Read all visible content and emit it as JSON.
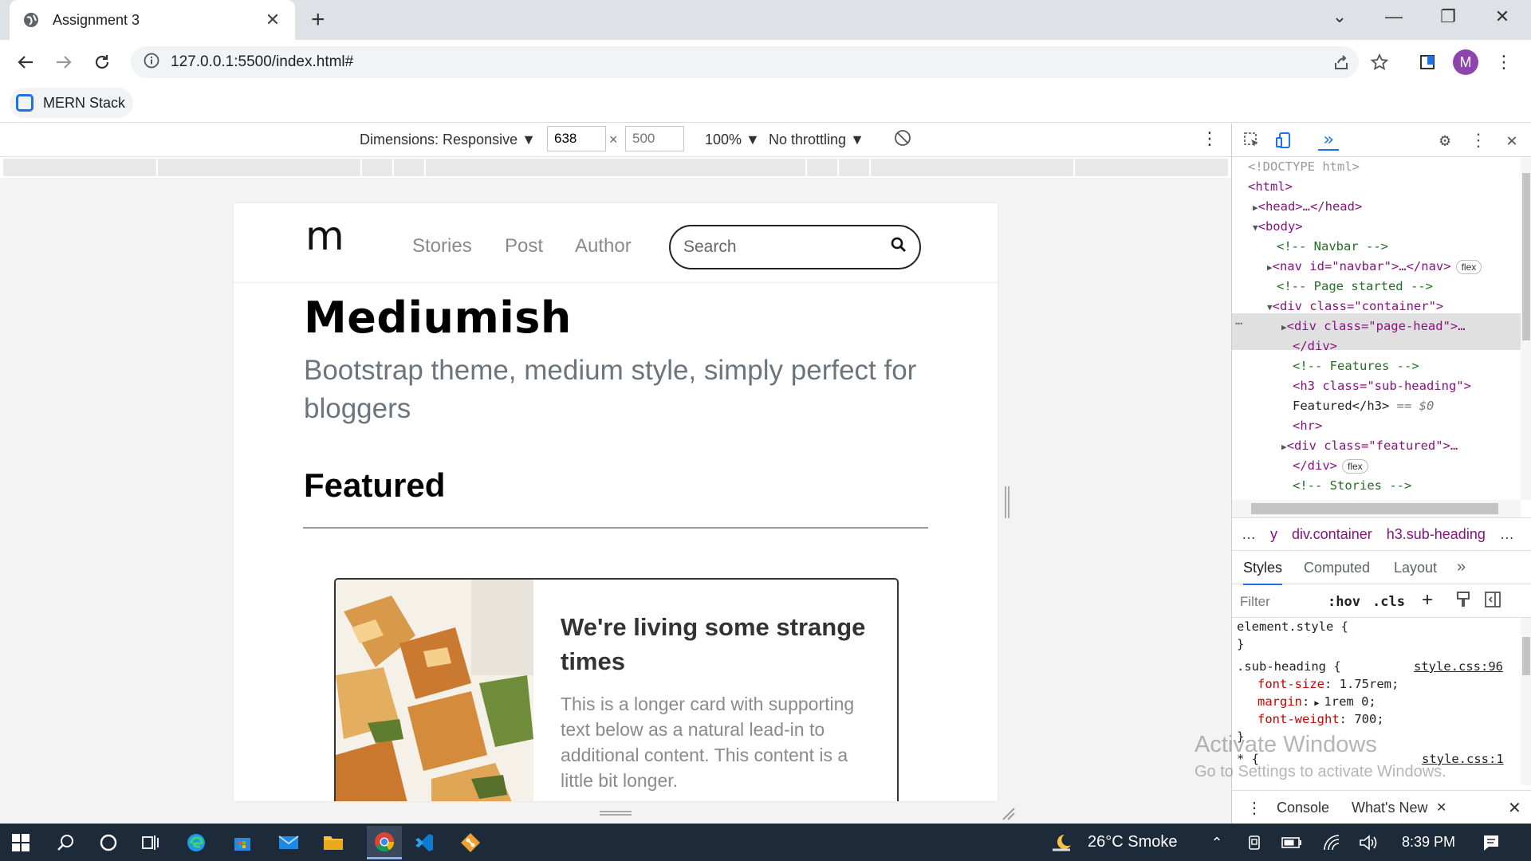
{
  "browser": {
    "tab_title": "Assignment 3",
    "url": "127.0.0.1:5500/index.html#",
    "bookmark": "MERN Stack",
    "profile_initial": "M"
  },
  "device_toolbar": {
    "dimensions": "Dimensions: Responsive",
    "width": "638",
    "height_placeholder": "500",
    "times": "×",
    "zoom": "100%",
    "throttling": "No throttling"
  },
  "site": {
    "logo": "m",
    "nav": [
      "Stories",
      "Post",
      "Author"
    ],
    "search_placeholder": "Search",
    "title": "Mediumish",
    "subtitle": "Bootstrap theme, medium style, simply perfect for bloggers",
    "section_heading": "Featured",
    "card_title": "We're living some strange times",
    "card_text": "This is a longer card with supporting text below as a natural lead-in to additional content. This content is a little bit longer."
  },
  "devtools": {
    "dom": [
      {
        "t": "<!DOCTYPE html>"
      },
      {
        "t": "<html>"
      },
      {
        "t": "<head>…</head>"
      },
      {
        "t": "<body>"
      },
      {
        "t": "<!-- Navbar -->"
      },
      {
        "t": "<nav id=\"navbar\">…</nav>",
        "pill": "flex"
      },
      {
        "t": "<!-- Page started -->"
      },
      {
        "t": "<div class=\"container\">"
      },
      {
        "t": "<div class=\"page-head\">…"
      },
      {
        "t": "</div>"
      },
      {
        "t": "<!-- Features -->"
      },
      {
        "t": "<h3 class=\"sub-heading\">"
      },
      {
        "t": "Featured</h3>",
        "suffix": "== $0"
      },
      {
        "t": "<hr>"
      },
      {
        "t": "<div class=\"featured\">…"
      },
      {
        "t": "</div>",
        "pill": "flex"
      },
      {
        "t": "<!-- Stories -->"
      }
    ],
    "crumbs": [
      "…",
      "y",
      "div.container",
      "h3.sub-heading",
      "…"
    ],
    "style_tabs": [
      "Styles",
      "Computed",
      "Layout"
    ],
    "filter_placeholder": "Filter",
    "hov": ":hov",
    "cls": ".cls",
    "rules": {
      "element_style": "element.style {",
      "close": "}",
      "selector": ".sub-heading {",
      "source": "style.css:96",
      "props": [
        {
          "name": "font-size",
          "value": "1.75rem;"
        },
        {
          "name": "margin",
          "value": "1rem 0;"
        },
        {
          "name": "font-weight",
          "value": "700;"
        }
      ],
      "universal": "* {",
      "source2": "style.css:1"
    },
    "drawer_tabs": [
      "Console",
      "What's New"
    ]
  },
  "watermark": {
    "line1": "Activate Windows",
    "line2": "Go to Settings to activate Windows."
  },
  "taskbar": {
    "weather": "26°C  Smoke",
    "time": "8:39 PM"
  }
}
